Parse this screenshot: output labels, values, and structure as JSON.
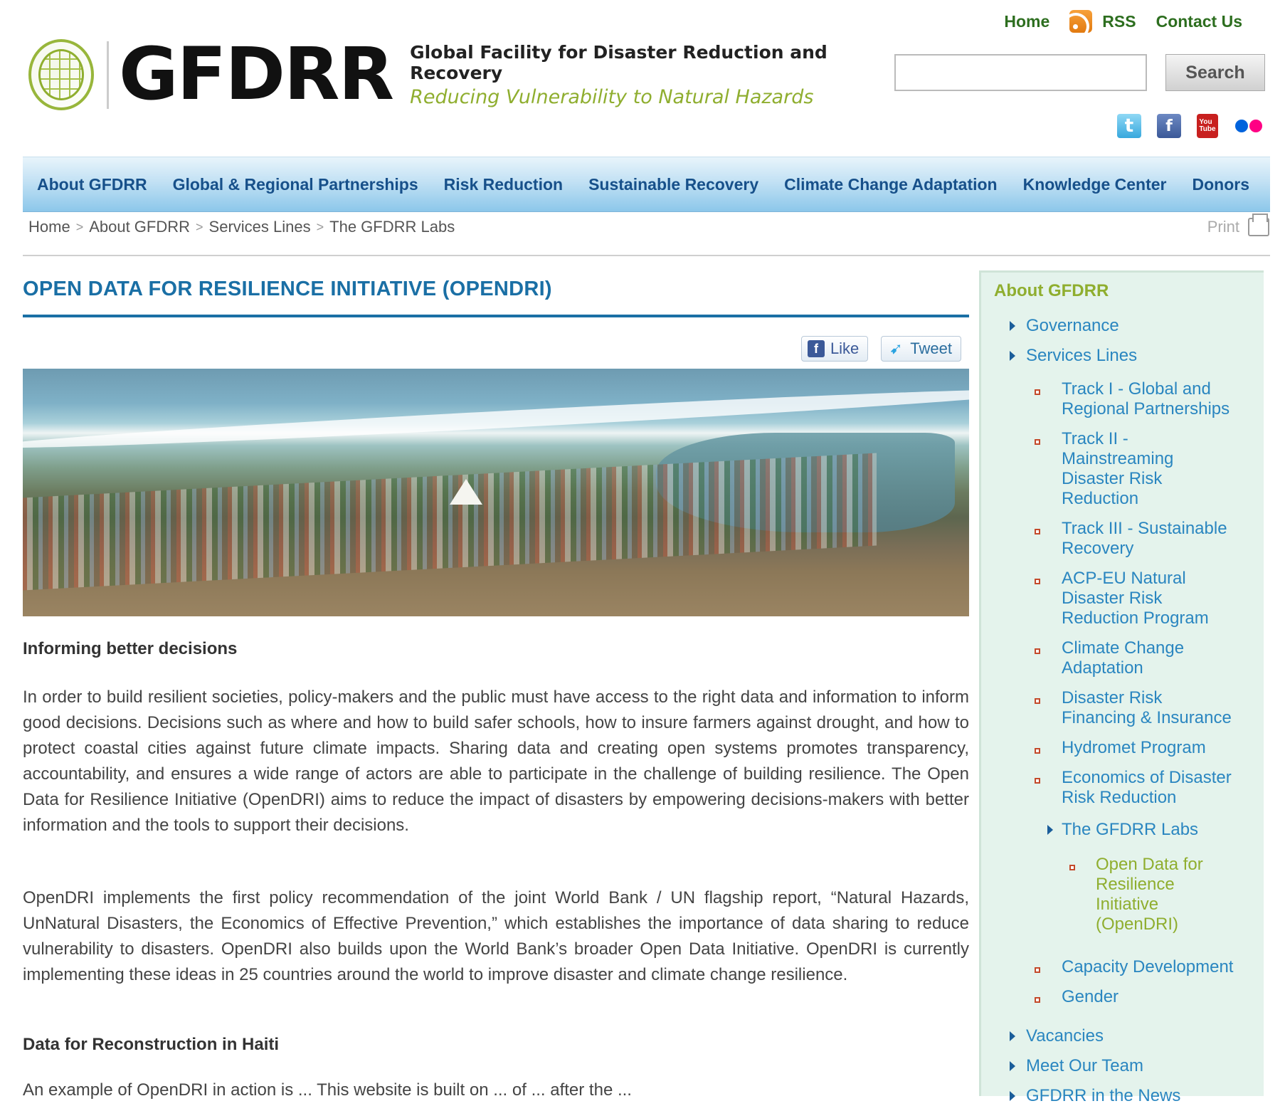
{
  "header": {
    "top_links": {
      "home": "Home",
      "rss": "RSS",
      "contact": "Contact Us"
    },
    "logo": {
      "name": "GFDRR",
      "tagline1": "Global Facility for Disaster Reduction and Recovery",
      "tagline2": "Reducing Vulnerability to Natural Hazards"
    },
    "search": {
      "button_label": "Search",
      "value": ""
    },
    "social_icons": [
      "twitter-icon",
      "facebook-icon",
      "youtube-icon",
      "flickr-icon"
    ]
  },
  "nav": {
    "items": [
      "About GFDRR",
      "Global & Regional Partnerships",
      "Risk Reduction",
      "Sustainable Recovery",
      "Climate Change Adaptation",
      "Knowledge Center",
      "Donors"
    ]
  },
  "breadcrumb": {
    "items": [
      "Home",
      "About GFDRR",
      "Services Lines",
      "The GFDRR Labs"
    ],
    "separator": ">",
    "print_label": "Print"
  },
  "main": {
    "title": "OPEN DATA FOR RESILIENCE INITIATIVE (OPENDRI)",
    "share": {
      "like": "Like",
      "tweet": "Tweet"
    },
    "heading1": "Informing better decisions",
    "para1": "In order to build resilient societies, policy-makers and the public must have access to the right data and information to inform good decisions.  Decisions such as where and how to build safer schools, how to insure farmers against drought, and how to protect coastal cities against future climate impacts. Sharing data and creating open systems promotes transparency, accountability, and ensures a wide range of actors are able to participate in the challenge of building resilience. The Open Data for Resilience Initiative (OpenDRI) aims to reduce the impact of disasters by empowering decisions-makers with better information and the tools to support their decisions.",
    "para2": "OpenDRI implements the first policy recommendation of the joint World Bank / UN flagship report, “Natural Hazards, UnNatural Disasters, the Economics of Effective Prevention,” which establishes the importance of data sharing to reduce vulnerability to disasters. OpenDRI also builds upon the World Bank’s broader Open Data Initiative. OpenDRI is currently implementing these ideas in 25 countries around the world to improve disaster and climate change resilience.",
    "heading2": "Data for Reconstruction in Haiti",
    "para3": "An example of OpenDRI in action is ... This website is built on ... of ... after the ..."
  },
  "sidebar": {
    "title": "About GFDRR",
    "governance": "Governance",
    "services_lines": "Services Lines",
    "track1": [
      "Track I - Global and",
      "Regional Partnerships"
    ],
    "track2": [
      "Track II -",
      "Mainstreaming",
      "Disaster Risk",
      "Reduction"
    ],
    "track3": [
      "Track III - Sustainable",
      "Recovery"
    ],
    "acp": [
      "ACP-EU Natural",
      "Disaster Risk",
      "Reduction Program"
    ],
    "climate": [
      "Climate Change",
      "Adaptation"
    ],
    "financing": [
      "Disaster Risk",
      "Financing & Insurance"
    ],
    "hydromet": "Hydromet Program",
    "economics": [
      "Economics of Disaster",
      "Risk Reduction"
    ],
    "labs": "The GFDRR Labs",
    "opendri": [
      "Open Data for",
      "Resilience",
      "Initiative",
      "(OpenDRI)"
    ],
    "capacity": "Capacity Development",
    "gender": "Gender",
    "vacancies": "Vacancies",
    "team": "Meet Our Team",
    "news": "GFDRR in the News"
  },
  "colors": {
    "nav_text": "#17508a",
    "title_blue": "#1a6fa5",
    "brand_green": "#8fae2f",
    "link_blue": "#2a86c0",
    "sidebar_bg": "#e4f3ec"
  }
}
